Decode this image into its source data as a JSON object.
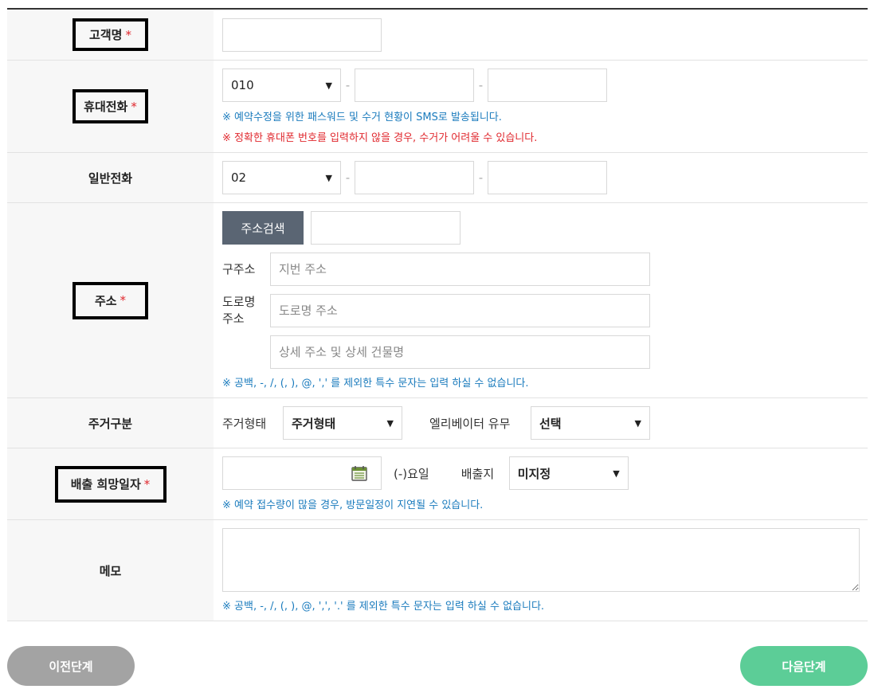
{
  "rows": {
    "customer_name": {
      "label": "고객명",
      "required": "*"
    },
    "mobile": {
      "label": "휴대전화",
      "required": "*",
      "prefix": "010",
      "notice_blue": "※ 예약수정을 위한 패스워드 및 수거 현황이 SMS로 발송됩니다.",
      "notice_red": "※ 정확한 휴대폰 번호를 입력하지 않을 경우, 수거가 어려울 수 있습니다."
    },
    "phone": {
      "label": "일반전화",
      "prefix": "02"
    },
    "address": {
      "label": "주소",
      "required": "*",
      "search_button": "주소검색",
      "old_label": "구주소",
      "old_placeholder": "지번 주소",
      "road_label": "도로명\n주소",
      "road_placeholder": "도로명 주소",
      "detail_placeholder": "상세 주소 및 상세 건물명",
      "notice": "※ 공백, -, /, (, ), @, ',' 를 제외한 특수 문자는 입력 하실 수 없습니다."
    },
    "housing": {
      "label": "주거구분",
      "type_label": "주거형태",
      "type_value": "주거형태",
      "elevator_label": "엘리베이터 유무",
      "elevator_value": "선택"
    },
    "date": {
      "label": "배출 희망일자",
      "required": "*",
      "weekday": "(-)요일",
      "place_label": "배출지",
      "place_value": "미지정",
      "notice": "※ 예약 접수량이 많을 경우, 방문일정이 지연될 수 있습니다."
    },
    "memo": {
      "label": "메모",
      "notice": "※ 공백, -, /, (, ), @, ',', '.' 를 제외한 특수 문자는 입력 하실 수 없습니다."
    }
  },
  "buttons": {
    "prev": "이전단계",
    "next": "다음단계"
  },
  "colors": {
    "accent_next": "#5ccd97",
    "prev_button": "#a3a3a3",
    "search_button": "#5a6573",
    "required": "#e0282e",
    "notice_blue": "#1a7bbd"
  }
}
